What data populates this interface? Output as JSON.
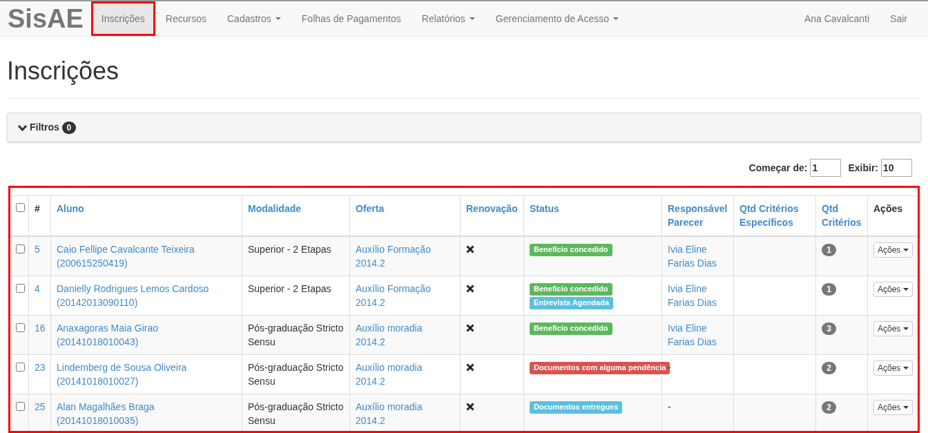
{
  "navbar": {
    "brand": "SisAE",
    "items": [
      {
        "label": "Inscrições",
        "selected": true,
        "highlighted": true,
        "dropdown": false
      },
      {
        "label": "Recursos",
        "selected": false,
        "highlighted": false,
        "dropdown": false
      },
      {
        "label": "Cadastros",
        "selected": false,
        "highlighted": false,
        "dropdown": true
      },
      {
        "label": "Folhas de Pagamentos",
        "selected": false,
        "highlighted": false,
        "dropdown": false
      },
      {
        "label": "Relatórios",
        "selected": false,
        "highlighted": false,
        "dropdown": true
      },
      {
        "label": "Gerenciamento de Acesso",
        "selected": false,
        "highlighted": false,
        "dropdown": true
      }
    ],
    "right_items": [
      "Ana Cavalcanti",
      "Sair"
    ]
  },
  "page_title": "Inscrições",
  "filters": {
    "label": "Filtros",
    "count": "0",
    "expanded": false
  },
  "paging": {
    "start_label": "Começar de:",
    "start_value": "1",
    "show_label": "Exibir:",
    "show_value": "10"
  },
  "table": {
    "highlighted": true,
    "select_all_checked": false,
    "columns": [
      "#",
      "Aluno",
      "Modalidade",
      "Oferta",
      "Renovação",
      "Status",
      "Responsável Parecer",
      "Qtd Critérios Específicos",
      "Qtd Critérios",
      "Ações"
    ],
    "rows": [
      {
        "checked": false,
        "number": "5",
        "aluno": "Caio Fellipe Cavalcante Teixeira",
        "matricula": "(200615250419)",
        "modalidade": "Superior - 2 Etapas",
        "oferta": "Auxílio Formação 2014.2",
        "renovacao": false,
        "status": [
          {
            "label": "Benefício concedido",
            "kind": "success"
          }
        ],
        "responsavel": "Ivia Eline Farias Dias",
        "qtd_especificos": "",
        "qtd_criterios": "1",
        "action": "Ações"
      },
      {
        "checked": false,
        "number": "4",
        "aluno": "Danielly Rodrigues Lemos Cardoso",
        "matricula": "(20142013090110)",
        "modalidade": "Superior - 2 Etapas",
        "oferta": "Auxílio Formação 2014.2",
        "renovacao": false,
        "status": [
          {
            "label": "Benefício concedido",
            "kind": "success"
          },
          {
            "label": "Entrevista Agendada",
            "kind": "info"
          }
        ],
        "responsavel": "Ivia Eline Farias Dias",
        "qtd_especificos": "",
        "qtd_criterios": "1",
        "action": "Ações"
      },
      {
        "checked": false,
        "number": "16",
        "aluno": "Anaxagoras Maia Girao",
        "matricula": "(20141018010043)",
        "modalidade": "Pós-graduação Stricto Sensu",
        "oferta": "Auxílio moradia 2014.2",
        "renovacao": false,
        "status": [
          {
            "label": "Benefício concedido",
            "kind": "success"
          }
        ],
        "responsavel": "Ivia Eline Farias Dias",
        "qtd_especificos": "",
        "qtd_criterios": "3",
        "action": "Ações"
      },
      {
        "checked": false,
        "number": "23",
        "aluno": "Lindemberg de Sousa Oliveira",
        "matricula": "(20141018010027)",
        "modalidade": "Pós-graduação Stricto Sensu",
        "oferta": "Auxílio moradia 2014.2",
        "renovacao": false,
        "status": [
          {
            "label": "Documentos com alguma pendência",
            "kind": "danger"
          }
        ],
        "responsavel": "-",
        "qtd_especificos": "",
        "qtd_criterios": "2",
        "action": "Ações"
      },
      {
        "checked": false,
        "number": "25",
        "aluno": "Alan Magalhães Braga",
        "matricula": "(20141018010035)",
        "modalidade": "Pós-graduação Stricto Sensu",
        "oferta": "Auxílio moradia 2014.2",
        "renovacao": false,
        "status": [
          {
            "label": "Documentos entregues",
            "kind": "info"
          }
        ],
        "responsavel": "-",
        "qtd_especificos": "",
        "qtd_criterios": "2",
        "action": "Ações"
      }
    ]
  }
}
